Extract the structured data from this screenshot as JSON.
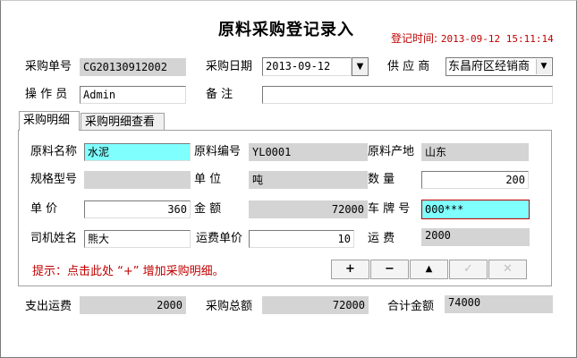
{
  "header": {
    "title": "原料采购登记录入",
    "reg_time_label": "登记时间:",
    "reg_time_value": "2013-09-12 15:11:14"
  },
  "form": {
    "order_no_label": "采购单号",
    "order_no": "CG20130912002",
    "purchase_date_label": "采购日期",
    "purchase_date": "2013-09-12",
    "supplier_label": "供 应 商",
    "supplier": "东昌府区经销商",
    "operator_label": "操 作 员",
    "operator": "Admin",
    "remark_label": "备    注",
    "remark": ""
  },
  "tabs": [
    {
      "label": "采购明细",
      "active": true
    },
    {
      "label": "采购明细查看",
      "active": false
    }
  ],
  "detail": {
    "material_name_label": "原料名称",
    "material_name": "水泥",
    "material_code_label": "原料编号",
    "material_code": "YL0001",
    "origin_label": "原料产地",
    "origin": "山东",
    "spec_label": "规格型号",
    "spec": "",
    "unit_label": "单    位",
    "unit": "吨",
    "quantity_label": "数    量",
    "quantity": "200",
    "price_label": "单    价",
    "price": "360",
    "amount_label": "金    额",
    "amount": "72000",
    "plate_label": "车 牌 号",
    "plate": "000***",
    "driver_label": "司机姓名",
    "driver": "熊大",
    "freight_price_label": "运费单价",
    "freight_price": "10",
    "freight_label": "运    费",
    "freight": "2000",
    "hint": "提示：点击此处 “+” 增加采购明细。"
  },
  "buttons": {
    "add": "+",
    "remove": "−",
    "up": "▲",
    "confirm": "✓",
    "cancel": "✕"
  },
  "totals": {
    "freight_paid_label": "支出运费",
    "freight_paid": "2000",
    "purchase_total_label": "采购总额",
    "purchase_total": "72000",
    "grand_total_label": "合计金额",
    "grand_total": "74000"
  },
  "colors": {
    "highlight": "#80ffff",
    "readonly": "#d4d4d4",
    "accent_red": "#c00000"
  }
}
